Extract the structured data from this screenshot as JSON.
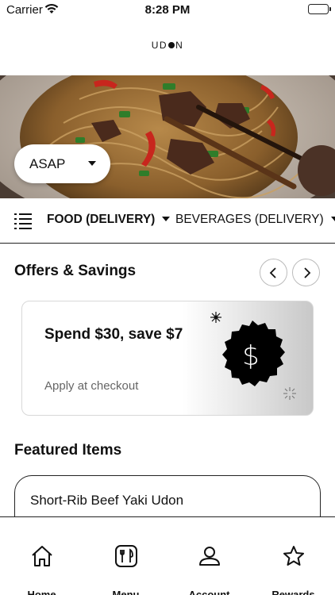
{
  "status": {
    "carrier": "Carrier",
    "time": "8:28 PM"
  },
  "brand": {
    "logo_left": "UD",
    "logo_right": "N"
  },
  "order_time": {
    "label": "ASAP"
  },
  "categories": [
    {
      "label": "FOOD (DELIVERY)",
      "selected": true
    },
    {
      "label": "BEVERAGES (DELIVERY)",
      "selected": false
    }
  ],
  "offers": {
    "title": "Offers & Savings",
    "card": {
      "headline": "Spend $30, save $7",
      "subtitle": "Apply at checkout",
      "badge_symbol": "$"
    }
  },
  "featured": {
    "title": "Featured Items",
    "items": [
      {
        "name": "Short-Rib Beef Yaki Udon"
      }
    ]
  },
  "tabs": [
    {
      "label": "Home",
      "icon": "home-icon"
    },
    {
      "label": "Menu",
      "icon": "menu-icon"
    },
    {
      "label": "Account",
      "icon": "account-icon"
    },
    {
      "label": "Rewards",
      "icon": "rewards-icon"
    }
  ],
  "colors": {
    "text": "#111111",
    "muted": "#666666",
    "border": "#222222"
  }
}
